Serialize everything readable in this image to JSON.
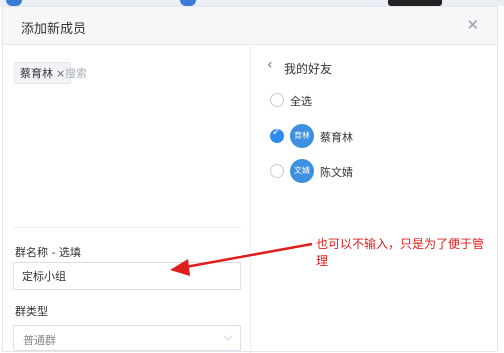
{
  "dialog": {
    "title": "添加新成员",
    "close_icon": "close-icon"
  },
  "left": {
    "selected_tag": {
      "name": "蔡育林",
      "remove_symbol": "×"
    },
    "search_placeholder": "搜索",
    "group_name_label": "群名称 - 选填",
    "group_name_value": "定标小组",
    "group_type_label": "群类型",
    "group_type_value": "普通群"
  },
  "right": {
    "title": "我的好友",
    "back_icon": "chevron-left-icon",
    "select_all_label": "全选",
    "friends": [
      {
        "name": "蔡育林",
        "avatar_text": "育林",
        "checked": true
      },
      {
        "name": "陈文婧",
        "avatar_text": "文婧",
        "checked": false
      }
    ]
  },
  "annotation": {
    "text": "也可以不输入，只是为了便于管理",
    "color": "#e01e1e"
  },
  "colors": {
    "accent": "#2d8cf0",
    "avatar": "#3d8fe0"
  }
}
